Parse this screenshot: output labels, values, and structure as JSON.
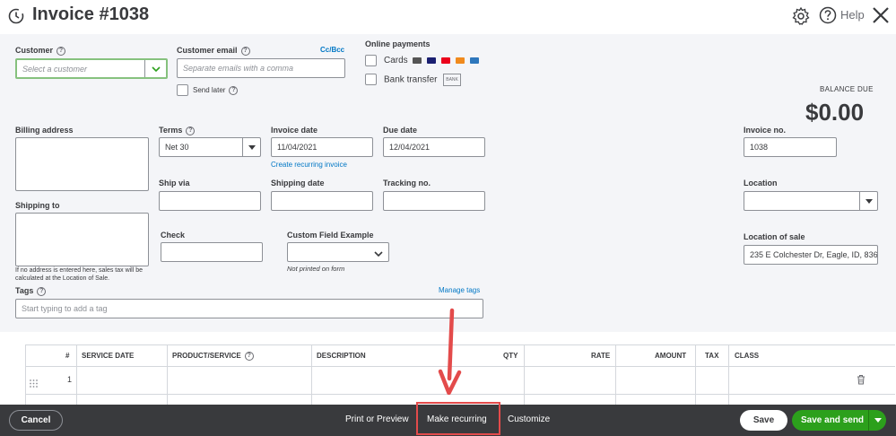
{
  "header": {
    "title": "Invoice #1038",
    "help_label": "Help"
  },
  "customer": {
    "label": "Customer",
    "placeholder": "Select a customer"
  },
  "customer_email": {
    "label": "Customer email",
    "placeholder": "Separate emails with a comma",
    "cc_bcc": "Cc/Bcc",
    "send_later": "Send later"
  },
  "online_payments": {
    "label": "Online payments",
    "cards": "Cards",
    "bank_transfer": "Bank transfer",
    "bank_badge": "BANK"
  },
  "balance": {
    "label": "BALANCE DUE",
    "value": "$0.00"
  },
  "billing": {
    "billing_label": "Billing address",
    "shipping_label": "Shipping to",
    "note": "If no address is entered here, sales tax will be calculated at the Location of Sale."
  },
  "terms": {
    "label": "Terms",
    "value": "Net 30"
  },
  "invoice_date": {
    "label": "Invoice date",
    "value": "11/04/2021",
    "recurring_link": "Create recurring invoice"
  },
  "due_date": {
    "label": "Due date",
    "value": "12/04/2021"
  },
  "invoice_no": {
    "label": "Invoice no.",
    "value": "1038"
  },
  "ship_via": {
    "label": "Ship via"
  },
  "shipping_date": {
    "label": "Shipping date"
  },
  "tracking_no": {
    "label": "Tracking no."
  },
  "location": {
    "label": "Location"
  },
  "check": {
    "label": "Check"
  },
  "custom_field": {
    "label": "Custom Field Example",
    "note": "Not printed on form"
  },
  "location_of_sale": {
    "label": "Location of sale",
    "value": "235 E Colchester Dr, Eagle, ID, 836"
  },
  "tags": {
    "label": "Tags",
    "manage": "Manage tags",
    "placeholder": "Start typing to add a tag"
  },
  "table": {
    "headers": {
      "num": "#",
      "service_date": "SERVICE DATE",
      "product": "PRODUCT/SERVICE",
      "description": "DESCRIPTION",
      "qty": "QTY",
      "rate": "RATE",
      "amount": "AMOUNT",
      "tax": "TAX",
      "class": "CLASS"
    },
    "rows": [
      {
        "num": "1"
      }
    ]
  },
  "footer": {
    "cancel": "Cancel",
    "print_preview": "Print or Preview",
    "make_recurring": "Make recurring",
    "customize": "Customize",
    "save": "Save",
    "save_and_send": "Save and send"
  },
  "colors": {
    "accent_green": "#2ca01c",
    "link_blue": "#0077c5",
    "annotation_red": "#e34b4b",
    "footer_bg": "#393a3d"
  }
}
